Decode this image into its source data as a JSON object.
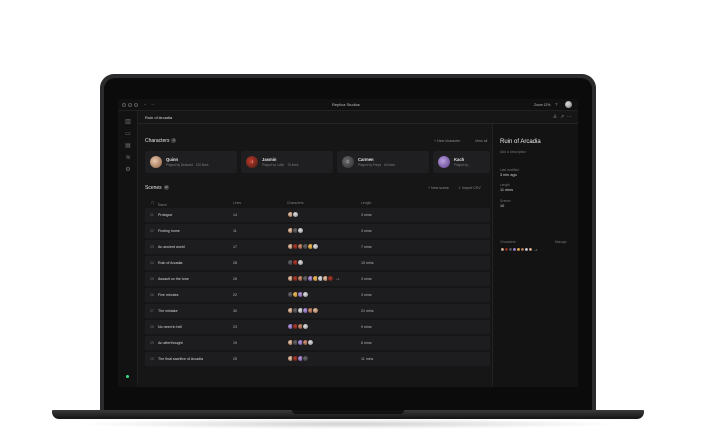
{
  "titlebar": {
    "app_title": "Replica Studios",
    "zoom": "Zoom 12%"
  },
  "breadcrumb": {
    "project": "Ruin of Arcadia"
  },
  "characters": {
    "title": "Characters",
    "count": "4",
    "new_label": "+ New character",
    "view_all": "View all",
    "cards": [
      {
        "initial": "",
        "name": "Quinn",
        "voice": "Played by Deckard",
        "lines": "120 lines",
        "avatar": "c1"
      },
      {
        "initial": "J",
        "name": "Jasmin",
        "voice": "Played by Lollin",
        "lines": "76 lines",
        "avatar": "c2"
      },
      {
        "initial": "C",
        "name": "Carmen",
        "voice": "Played by Freya",
        "lines": "64 lines",
        "avatar": "c3"
      },
      {
        "initial": "",
        "name": "Kach",
        "voice": "Played by...",
        "lines": "",
        "avatar": "c4"
      }
    ]
  },
  "scenes": {
    "title": "Scenes",
    "count": "10",
    "new_label": "+ New scene",
    "import_label": "Import CSV",
    "columns": {
      "name": "Name",
      "lines": "Lines",
      "characters": "Characters",
      "length": "Length"
    },
    "rows": [
      {
        "num": "01",
        "title": "Prologue",
        "lines": "14",
        "length": "3 mins",
        "avatars": [
          "c1",
          "c6"
        ],
        "more": ""
      },
      {
        "num": "02",
        "title": "Finding home",
        "lines": "11",
        "length": "3 mins",
        "avatars": [
          "c1",
          "c3",
          "c6"
        ],
        "more": ""
      },
      {
        "num": "03",
        "title": "An ancient world",
        "lines": "17",
        "length": "7 mins",
        "avatars": [
          "c1",
          "c2",
          "c7",
          "c3",
          "c5",
          "c6"
        ],
        "more": ""
      },
      {
        "num": "04",
        "title": "Ruin of Arcadia",
        "lines": "28",
        "length": "15 mins",
        "avatars": [
          "c3",
          "c2",
          "c6"
        ],
        "more": ""
      },
      {
        "num": "05",
        "title": "Assault on the tune",
        "lines": "26",
        "length": "3 mins",
        "avatars": [
          "c1",
          "c2",
          "c7",
          "c3",
          "c4",
          "c5",
          "c6",
          "c1",
          "c2"
        ],
        "more": "+4"
      },
      {
        "num": "06",
        "title": "Five minutes",
        "lines": "22",
        "length": "3 mins",
        "avatars": [
          "c3",
          "c5",
          "c4",
          "c6"
        ],
        "more": ""
      },
      {
        "num": "07",
        "title": "The mistake",
        "lines": "30",
        "length": "21 mins",
        "avatars": [
          "c1",
          "c3",
          "c6",
          "c4",
          "c7",
          "c1"
        ],
        "more": ""
      },
      {
        "num": "08",
        "title": "No need in hell",
        "lines": "23",
        "length": "9 mins",
        "avatars": [
          "c4",
          "c2",
          "c7",
          "c6"
        ],
        "more": ""
      },
      {
        "num": "09",
        "title": "An afterthought",
        "lines": "19",
        "length": "6 mins",
        "avatars": [
          "c1",
          "c3",
          "c4",
          "c7",
          "c6"
        ],
        "more": ""
      },
      {
        "num": "10",
        "title": "The final sacrifice of Arcadia",
        "lines": "25",
        "length": "11 mins",
        "avatars": [
          "c1",
          "c2",
          "c4",
          "c3"
        ],
        "more": ""
      }
    ]
  },
  "panel": {
    "title": "Ruin of Arcadia",
    "desc": "Add a description",
    "last_modified_label": "Last modified",
    "last_modified": "3 min ago",
    "length_label": "Length",
    "length": "11 mins",
    "scenes_label": "Scenes",
    "scenes": "10",
    "characters_label": "Characters",
    "manage_label": "Manage",
    "more": "+4"
  }
}
